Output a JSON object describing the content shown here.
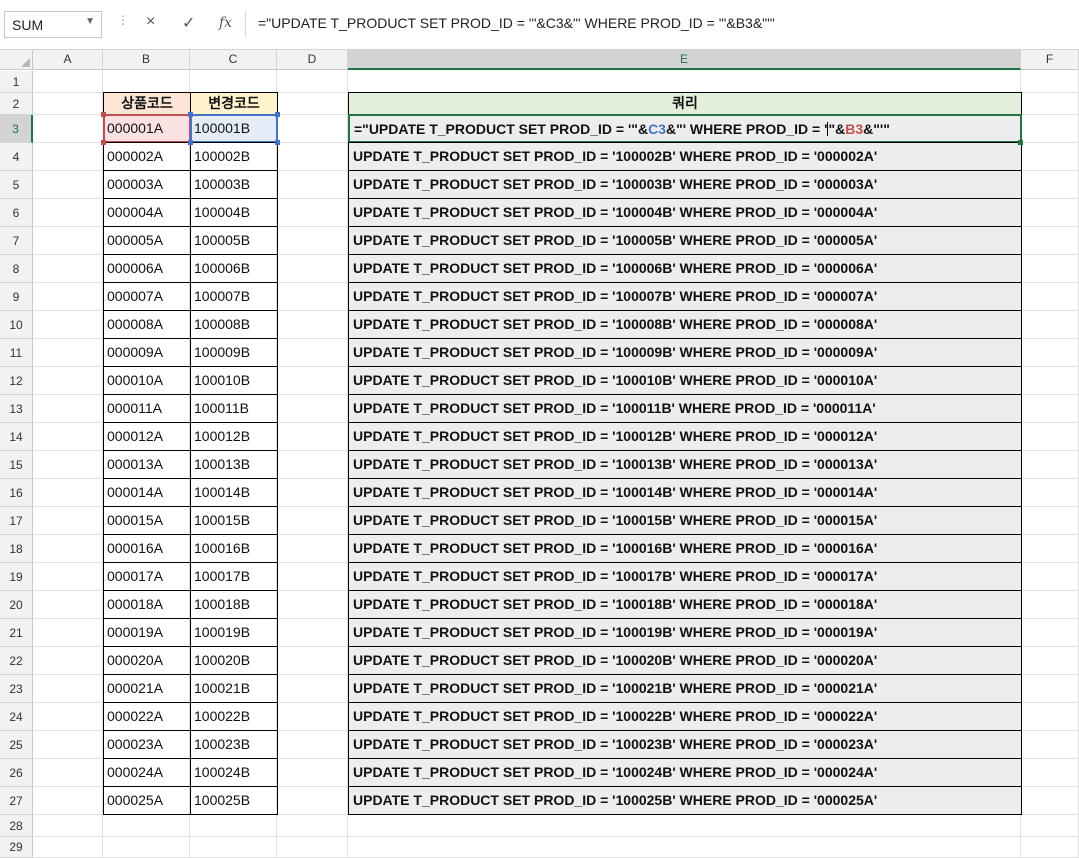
{
  "formula_bar": {
    "name_box": "SUM",
    "cancel_icon": "×",
    "enter_icon": "✓",
    "fx_icon": "fx",
    "formula": "=\"UPDATE T_PRODUCT SET PROD_ID = '\"&C3&\"' WHERE PROD_ID = '\"&B3&\"'\""
  },
  "columns": [
    "A",
    "B",
    "C",
    "D",
    "E",
    "F"
  ],
  "rows": [
    "1",
    "2",
    "3",
    "4",
    "5",
    "6",
    "7",
    "8",
    "9",
    "10",
    "11",
    "12",
    "13",
    "14",
    "15",
    "16",
    "17",
    "18",
    "19",
    "20",
    "21",
    "22",
    "23",
    "24",
    "25",
    "26",
    "27",
    "28",
    "29"
  ],
  "selected_column": "E",
  "selected_row": "3",
  "headers": {
    "b": "상품코드",
    "c": "변경코드",
    "e": "쿼리"
  },
  "edit_formula": {
    "p1": "=\"UPDATE T_PRODUCT SET PROD_ID = '\"&",
    "ref1": "C3",
    "p2": "&\"' WHERE PROD_ID = '",
    "p3": "\"&",
    "ref2": "B3",
    "p4": "&\"'\""
  },
  "data_rows": [
    {
      "b": "000001A",
      "c": "100001B",
      "e": ""
    },
    {
      "b": "000002A",
      "c": "100002B",
      "e": "UPDATE T_PRODUCT SET PROD_ID = '100002B' WHERE PROD_ID = '000002A'"
    },
    {
      "b": "000003A",
      "c": "100003B",
      "e": "UPDATE T_PRODUCT SET PROD_ID = '100003B' WHERE PROD_ID = '000003A'"
    },
    {
      "b": "000004A",
      "c": "100004B",
      "e": "UPDATE T_PRODUCT SET PROD_ID = '100004B' WHERE PROD_ID = '000004A'"
    },
    {
      "b": "000005A",
      "c": "100005B",
      "e": "UPDATE T_PRODUCT SET PROD_ID = '100005B' WHERE PROD_ID = '000005A'"
    },
    {
      "b": "000006A",
      "c": "100006B",
      "e": "UPDATE T_PRODUCT SET PROD_ID = '100006B' WHERE PROD_ID = '000006A'"
    },
    {
      "b": "000007A",
      "c": "100007B",
      "e": "UPDATE T_PRODUCT SET PROD_ID = '100007B' WHERE PROD_ID = '000007A'"
    },
    {
      "b": "000008A",
      "c": "100008B",
      "e": "UPDATE T_PRODUCT SET PROD_ID = '100008B' WHERE PROD_ID = '000008A'"
    },
    {
      "b": "000009A",
      "c": "100009B",
      "e": "UPDATE T_PRODUCT SET PROD_ID = '100009B' WHERE PROD_ID = '000009A'"
    },
    {
      "b": "000010A",
      "c": "100010B",
      "e": "UPDATE T_PRODUCT SET PROD_ID = '100010B' WHERE PROD_ID = '000010A'"
    },
    {
      "b": "000011A",
      "c": "100011B",
      "e": "UPDATE T_PRODUCT SET PROD_ID = '100011B' WHERE PROD_ID = '000011A'"
    },
    {
      "b": "000012A",
      "c": "100012B",
      "e": "UPDATE T_PRODUCT SET PROD_ID = '100012B' WHERE PROD_ID = '000012A'"
    },
    {
      "b": "000013A",
      "c": "100013B",
      "e": "UPDATE T_PRODUCT SET PROD_ID = '100013B' WHERE PROD_ID = '000013A'"
    },
    {
      "b": "000014A",
      "c": "100014B",
      "e": "UPDATE T_PRODUCT SET PROD_ID = '100014B' WHERE PROD_ID = '000014A'"
    },
    {
      "b": "000015A",
      "c": "100015B",
      "e": "UPDATE T_PRODUCT SET PROD_ID = '100015B' WHERE PROD_ID = '000015A'"
    },
    {
      "b": "000016A",
      "c": "100016B",
      "e": "UPDATE T_PRODUCT SET PROD_ID = '100016B' WHERE PROD_ID = '000016A'"
    },
    {
      "b": "000017A",
      "c": "100017B",
      "e": "UPDATE T_PRODUCT SET PROD_ID = '100017B' WHERE PROD_ID = '000017A'"
    },
    {
      "b": "000018A",
      "c": "100018B",
      "e": "UPDATE T_PRODUCT SET PROD_ID = '100018B' WHERE PROD_ID = '000018A'"
    },
    {
      "b": "000019A",
      "c": "100019B",
      "e": "UPDATE T_PRODUCT SET PROD_ID = '100019B' WHERE PROD_ID = '000019A'"
    },
    {
      "b": "000020A",
      "c": "100020B",
      "e": "UPDATE T_PRODUCT SET PROD_ID = '100020B' WHERE PROD_ID = '000020A'"
    },
    {
      "b": "000021A",
      "c": "100021B",
      "e": "UPDATE T_PRODUCT SET PROD_ID = '100021B' WHERE PROD_ID = '000021A'"
    },
    {
      "b": "000022A",
      "c": "100022B",
      "e": "UPDATE T_PRODUCT SET PROD_ID = '100022B' WHERE PROD_ID = '000022A'"
    },
    {
      "b": "000023A",
      "c": "100023B",
      "e": "UPDATE T_PRODUCT SET PROD_ID = '100023B' WHERE PROD_ID = '000023A'"
    },
    {
      "b": "000024A",
      "c": "100024B",
      "e": "UPDATE T_PRODUCT SET PROD_ID = '100024B' WHERE PROD_ID = '000024A'"
    },
    {
      "b": "000025A",
      "c": "100025B",
      "e": "UPDATE T_PRODUCT SET PROD_ID = '100025B' WHERE PROD_ID = '000025A'"
    }
  ],
  "colors": {
    "selection_green": "#217346",
    "ref_b3_red": "#c0504d",
    "ref_c3_blue": "#4472c4",
    "header_b_fill": "#fce4d6",
    "header_c_fill": "#fff2cc",
    "header_e_fill": "#e2efda",
    "query_fill": "#ededed"
  }
}
